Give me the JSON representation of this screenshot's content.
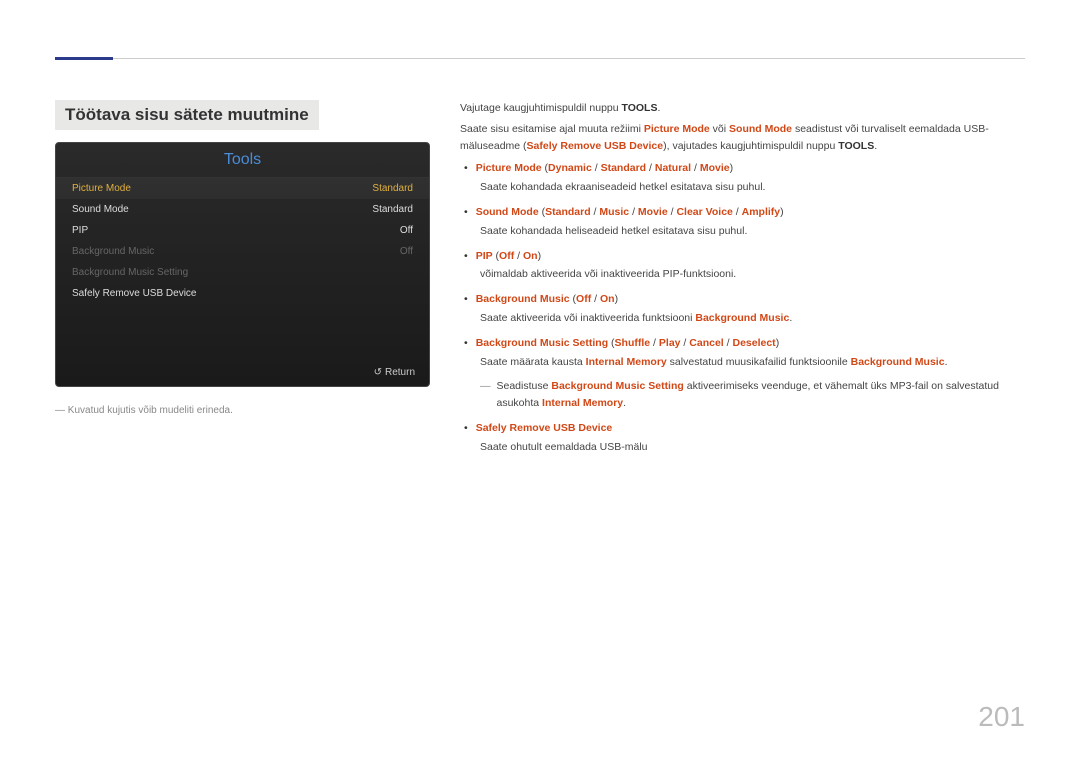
{
  "section_title": "Töötava sisu sätete muutmine",
  "tools_panel": {
    "title": "Tools",
    "rows": [
      {
        "label": "Picture Mode",
        "value": "Standard",
        "state": "selected"
      },
      {
        "label": "Sound Mode",
        "value": "Standard",
        "state": "normal"
      },
      {
        "label": "PIP",
        "value": "Off",
        "state": "normal"
      },
      {
        "label": "Background Music",
        "value": "Off",
        "state": "disabled"
      },
      {
        "label": "Background Music Setting",
        "value": "",
        "state": "disabled"
      },
      {
        "label": "Safely Remove USB Device",
        "value": "",
        "state": "normal"
      }
    ],
    "return_label": "Return"
  },
  "footnote": "Kuvatud kujutis võib mudeliti erineda.",
  "body": {
    "p1_a": "Vajutage kaugjuhtimispuldil nuppu ",
    "p1_b": "TOOLS",
    "p1_c": ".",
    "p2_a": "Saate sisu esitamise ajal muuta režiimi ",
    "p2_b": "Picture Mode",
    "p2_c": " või ",
    "p2_d": "Sound Mode",
    "p2_e": " seadistust või turvaliselt eemaldada USB-mäluseadme (",
    "p2_f": "Safely Remove USB Device",
    "p2_g": "), vajutades kaugjuhtimispuldil nuppu ",
    "p2_h": "TOOLS",
    "p2_i": ".",
    "b1": {
      "t1": "Picture Mode",
      "t2": " (",
      "t3": "Dynamic",
      "t4": " / ",
      "t5": "Standard",
      "t6": " / ",
      "t7": "Natural",
      "t8": " / ",
      "t9": "Movie",
      "t10": ")"
    },
    "b1_desc": "Saate kohandada ekraaniseadeid hetkel esitatava sisu puhul.",
    "b2": {
      "t1": "Sound Mode",
      "t2": " (",
      "t3": "Standard",
      "t4": " / ",
      "t5": "Music",
      "t6": " / ",
      "t7": "Movie",
      "t8": " / ",
      "t9": "Clear Voice",
      "t10": " / ",
      "t11": "Amplify",
      "t12": ")"
    },
    "b2_desc": "Saate kohandada heliseadeid hetkel esitatava sisu puhul.",
    "b3": {
      "t1": "PIP",
      "t2": " (",
      "t3": "Off",
      "t4": " / ",
      "t5": "On",
      "t6": ")"
    },
    "b3_desc": "võimaldab aktiveerida või inaktiveerida PIP-funktsiooni.",
    "b4": {
      "t1": "Background Music",
      "t2": " (",
      "t3": "Off",
      "t4": " / ",
      "t5": "On",
      "t6": ")"
    },
    "b4_desc_a": "Saate aktiveerida või inaktiveerida funktsiooni ",
    "b4_desc_b": "Background Music",
    "b4_desc_c": ".",
    "b5": {
      "t1": "Background Music Setting",
      "t2": " (",
      "t3": "Shuffle",
      "t4": " / ",
      "t5": "Play",
      "t6": " / ",
      "t7": "Cancel",
      "t8": " / ",
      "t9": "Deselect",
      "t10": ")"
    },
    "b5_desc_a": "Saate määrata kausta ",
    "b5_desc_b": "Internal Memory",
    "b5_desc_c": " salvestatud muusikafailid funktsioonile ",
    "b5_desc_d": "Background Music",
    "b5_desc_e": ".",
    "note_a": "Seadistuse ",
    "note_b": "Background Music Setting",
    "note_c": " aktiveerimiseks veenduge, et vähemalt üks MP3-fail on salvestatud asukohta ",
    "note_d": "Internal Memory",
    "note_e": ".",
    "b6": "Safely Remove USB Device",
    "b6_desc": "Saate ohutult eemaldada USB-mälu"
  },
  "page_number": "201"
}
